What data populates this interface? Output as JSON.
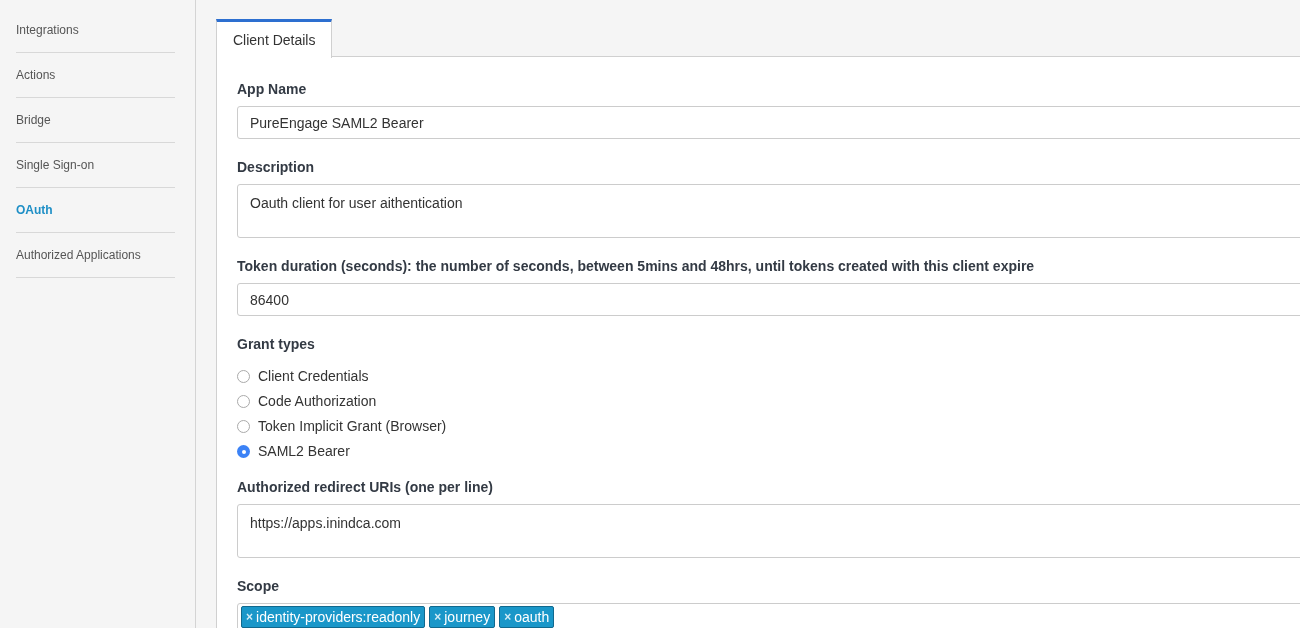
{
  "sidebar": {
    "items": [
      {
        "label": "Integrations",
        "selected": false
      },
      {
        "label": "Actions",
        "selected": false
      },
      {
        "label": "Bridge",
        "selected": false
      },
      {
        "label": "Single Sign-on",
        "selected": false
      },
      {
        "label": "OAuth",
        "selected": true
      },
      {
        "label": "Authorized Applications",
        "selected": false
      }
    ]
  },
  "tabs": [
    {
      "label": "Client Details",
      "selected": true
    }
  ],
  "form": {
    "app_name": {
      "label": "App Name",
      "value": "PureEngage SAML2 Bearer"
    },
    "description": {
      "label": "Description",
      "value": "Oauth client for user aithentication"
    },
    "token_duration": {
      "label": "Token duration (seconds): the number of seconds, between 5mins and 48hrs, until tokens created with this client expire",
      "value": "86400"
    },
    "grant_types": {
      "label": "Grant types",
      "options": [
        {
          "label": "Client Credentials",
          "selected": false
        },
        {
          "label": "Code Authorization",
          "selected": false
        },
        {
          "label": "Token Implicit Grant (Browser)",
          "selected": false
        },
        {
          "label": "SAML2 Bearer",
          "selected": true
        }
      ]
    },
    "redirect_uris": {
      "label": "Authorized redirect URIs (one per line)",
      "value": "https://apps.inindca.com"
    },
    "scope": {
      "label": "Scope",
      "tags": [
        {
          "label": "identity-providers:readonly",
          "remove": "×"
        },
        {
          "label": "journey",
          "remove": "×"
        },
        {
          "label": "oauth",
          "remove": "×"
        }
      ]
    }
  }
}
